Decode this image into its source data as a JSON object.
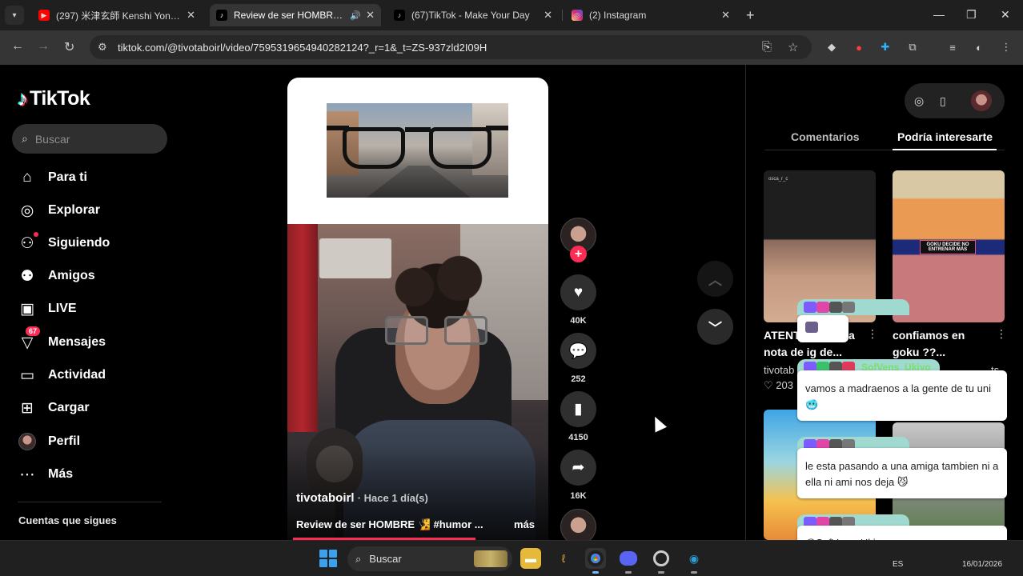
{
  "browser": {
    "tabs": [
      {
        "title": "(297) 米津玄師 Kenshi Yonezu -",
        "favicon": "youtube-icon",
        "color": "#ff0000"
      },
      {
        "title": "Review de ser HOMBRE 🧏",
        "favicon": "tiktok-icon",
        "color": "#000000",
        "active": true
      },
      {
        "title": "(67)TikTok - Make Your Day",
        "favicon": "tiktok-icon",
        "color": "#000000"
      },
      {
        "title": "(2) Instagram",
        "favicon": "instagram-icon",
        "color": "#d62976"
      }
    ],
    "url": "tiktok.com/@tivotaboirl/video/7595319654940282124?_r=1&_t=ZS-937zld2I09H"
  },
  "sidebar": {
    "logo": "TikTok",
    "search_placeholder": "Buscar",
    "items": [
      {
        "label": "Para ti",
        "icon": "home-icon"
      },
      {
        "label": "Explorar",
        "icon": "compass-icon"
      },
      {
        "label": "Siguiendo",
        "icon": "following-icon"
      },
      {
        "label": "Amigos",
        "icon": "friends-icon"
      },
      {
        "label": "LIVE",
        "icon": "live-icon"
      },
      {
        "label": "Mensajes",
        "icon": "messages-icon",
        "badge": "67"
      },
      {
        "label": "Actividad",
        "icon": "activity-icon"
      },
      {
        "label": "Cargar",
        "icon": "upload-icon"
      },
      {
        "label": "Perfil",
        "icon": "avatar"
      },
      {
        "label": "Más",
        "icon": "more-icon"
      }
    ],
    "following_header": "Cuentas que sigues"
  },
  "video": {
    "author": "tivotaboirl",
    "time": "· Hace 1 día(s)",
    "caption": "Review de ser HOMBRE 🧏 #humor ...",
    "more": "más",
    "progress": 0.7
  },
  "actions": {
    "likes": "40K",
    "comments": "252",
    "saves": "4150",
    "shares": "16K"
  },
  "right_panel": {
    "tabs": [
      "Comentarios",
      "Podría interesarte"
    ],
    "active_tab": 1,
    "cards": [
      {
        "title_line1": "ATENT",
        "title_tail": "a",
        "title_line2": "nota de ig de...",
        "author": "tivotab",
        "likes": "203"
      },
      {
        "title_line1": "confiamos en",
        "title_line2": "goku ??...",
        "thumb_caption": "GOKU DECIDE NO ENTRENAR MÁS",
        "author_tail": "ts"
      }
    ],
    "thumb1_header": "osca_r_c"
  },
  "chat": [
    {
      "user": "",
      "message": ""
    },
    {
      "user": "SofVens_Ukiyo",
      "message": "vamos a madraenos a la gente de tu uni 🥶"
    },
    {
      "user": "",
      "message": "le esta pasando a una amiga tambien ni a ella ni ami nos deja 😼"
    },
    {
      "user": "",
      "message": "@SofVens_Ukiyo vamos"
    }
  ],
  "taskbar": {
    "search": "Buscar",
    "lang": "ES",
    "date": "16/01/2026"
  }
}
